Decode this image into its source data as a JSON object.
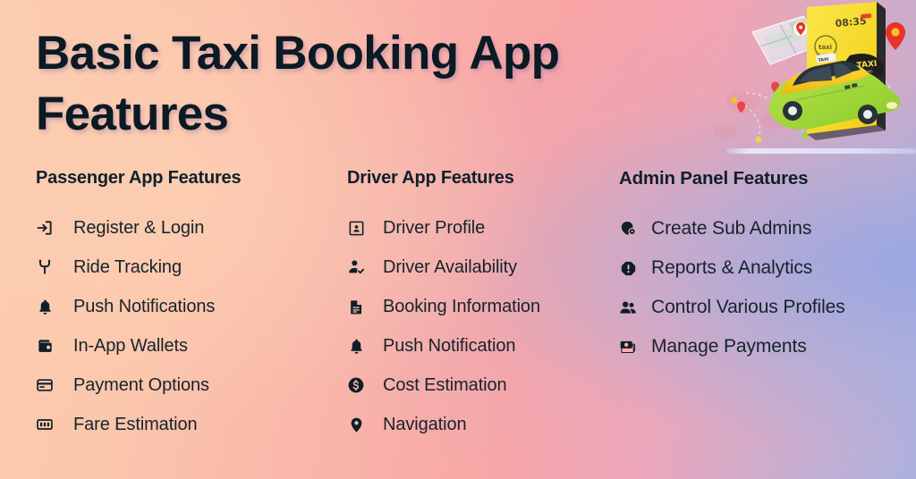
{
  "page": {
    "title": "Basic Taxi Booking App Features",
    "background": {
      "left_color": "#FBC9AE",
      "mid_color": "#F7A6A6",
      "right_color": "#A5B2E2"
    },
    "text_color": "#101E28"
  },
  "columns": [
    {
      "id": "passenger",
      "heading": "Passenger App Features",
      "items": [
        {
          "icon": "login-arrow-icon",
          "label": "Register & Login"
        },
        {
          "icon": "route-fork-icon",
          "label": "Ride Tracking"
        },
        {
          "icon": "bell-icon",
          "label": "Push Notifications"
        },
        {
          "icon": "wallet-icon",
          "label": "In-App Wallets"
        },
        {
          "icon": "credit-card-icon",
          "label": "Payment Options"
        },
        {
          "icon": "banknote-icon",
          "label": "Fare Estimation"
        }
      ]
    },
    {
      "id": "driver",
      "heading": "Driver App Features",
      "items": [
        {
          "icon": "id-card-icon",
          "label": "Driver Profile"
        },
        {
          "icon": "person-check-icon",
          "label": "Driver Availability"
        },
        {
          "icon": "document-icon",
          "label": "Booking Information"
        },
        {
          "icon": "bell-icon",
          "label": "Push Notification"
        },
        {
          "icon": "dollar-coin-icon",
          "label": "Cost Estimation"
        },
        {
          "icon": "location-pin-icon",
          "label": "Navigation"
        }
      ]
    },
    {
      "id": "admin",
      "heading": "Admin Panel Features",
      "items": [
        {
          "icon": "user-badge-icon",
          "label": "Create Sub Admins"
        },
        {
          "icon": "alert-octagon-icon",
          "label": "Reports & Analytics"
        },
        {
          "icon": "users-group-icon",
          "label": "Control Various Profiles"
        },
        {
          "icon": "cash-stack-icon",
          "label": "Manage Payments"
        }
      ]
    }
  ],
  "illustration": {
    "name": "taxi-booking-illustration",
    "phone_time": "08:35",
    "bubble_label": "TAXI",
    "taxi_sign_label": "TAXI",
    "colors": {
      "phone": "#F7DC2E",
      "taxi_body": "#9ED93B",
      "taxi_hood": "#F5C518",
      "pin": "#E8332A"
    }
  }
}
